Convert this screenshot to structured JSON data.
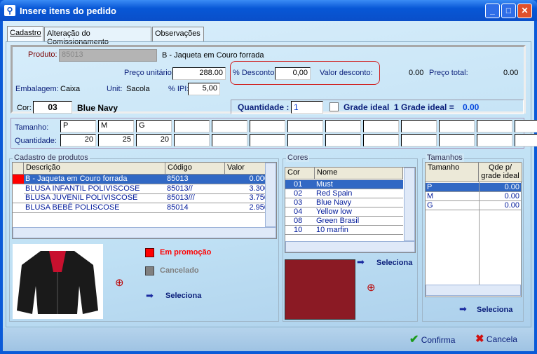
{
  "window": {
    "title": "Insere itens do pedido",
    "buttons": [
      "minimize",
      "maximize",
      "close"
    ]
  },
  "tabs": [
    {
      "label": "Cadastro",
      "active": true
    },
    {
      "label": "Alteração do Comissionamento"
    },
    {
      "label": "Observações"
    }
  ],
  "product": {
    "label": "Produto:",
    "code": "85013",
    "name": "B - Jaqueta em Couro forrada",
    "unit_price_label": "Preço unitário:",
    "unit_price": "288.00",
    "discount_pct_label": "% Desconto:",
    "discount_pct": "0,00",
    "discount_value_label": "Valor desconto:",
    "discount_value": "0.00",
    "total_label": "Preço total:",
    "total": "0.00",
    "packaging_label": "Embalagem:",
    "packaging": "Caixa",
    "unit_label": "Unit:",
    "unit": "Sacola",
    "ipi_label": "% IPI:",
    "ipi": "5,00"
  },
  "color": {
    "label": "Cor:",
    "code": "03",
    "name": "Blue Navy"
  },
  "quantity": {
    "label": "Quantidade :",
    "value": "1",
    "grade_label": "Grade ideal",
    "grade_checked": false,
    "grade_summary_label": "1 Grade ideal =",
    "grade_summary_value": "0.00"
  },
  "sizes": {
    "size_label": "Tamanho:",
    "qty_label": "Quantidade:",
    "sizes": [
      "P",
      "M",
      "G",
      "",
      "",
      "",
      "",
      "",
      "",
      "",
      "",
      "",
      ""
    ],
    "quantities": [
      "20",
      "25",
      "20",
      "",
      "",
      "",
      "",
      "",
      "",
      "",
      "",
      "",
      ""
    ]
  },
  "products_panel": {
    "title": "Cadastro de produtos",
    "columns": [
      "Descrição",
      "Código",
      "Valor"
    ],
    "rows": [
      {
        "desc": "B - Jaqueta em Couro forrada",
        "code": "85013",
        "value": "0.000"
      },
      {
        "desc": "BLUSA INFANTIL POLIVISCOSE",
        "code": "85013//",
        "value": "3.300"
      },
      {
        "desc": "BLUSA JUVENIL POLIVISCOSE",
        "code": "85013///",
        "value": "3.750"
      },
      {
        "desc": "BLUSA BEBÊ POLISCOSE",
        "code": "85014",
        "value": "2.950"
      }
    ],
    "legend_promo": "Em promoção",
    "legend_cancel": "Cancelado",
    "select_label": "Seleciona",
    "promo_color": "#ff0000",
    "cancel_color": "#808080"
  },
  "colors_panel": {
    "title": "Cores",
    "columns": [
      "Cor",
      "Nome"
    ],
    "rows": [
      {
        "code": "01",
        "name": "Must"
      },
      {
        "code": "02",
        "name": "Red Spain"
      },
      {
        "code": "03",
        "name": "Blue Navy"
      },
      {
        "code": "04",
        "name": "Yellow low"
      },
      {
        "code": "08",
        "name": "Green Brasil"
      },
      {
        "code": "10",
        "name": "10 marfin"
      }
    ],
    "select_label": "Seleciona",
    "swatch_color": "#8b1a24"
  },
  "sizes_panel": {
    "title": "Tamanhos",
    "columns": [
      "Tamanho",
      "Qde p/ grade ideal"
    ],
    "rows": [
      {
        "size": "P",
        "qty": "0.00"
      },
      {
        "size": "M",
        "qty": "0.00"
      },
      {
        "size": "G",
        "qty": "0.00"
      }
    ],
    "select_label": "Seleciona"
  },
  "footer": {
    "confirm": "Confirma",
    "cancel": "Cancela"
  }
}
